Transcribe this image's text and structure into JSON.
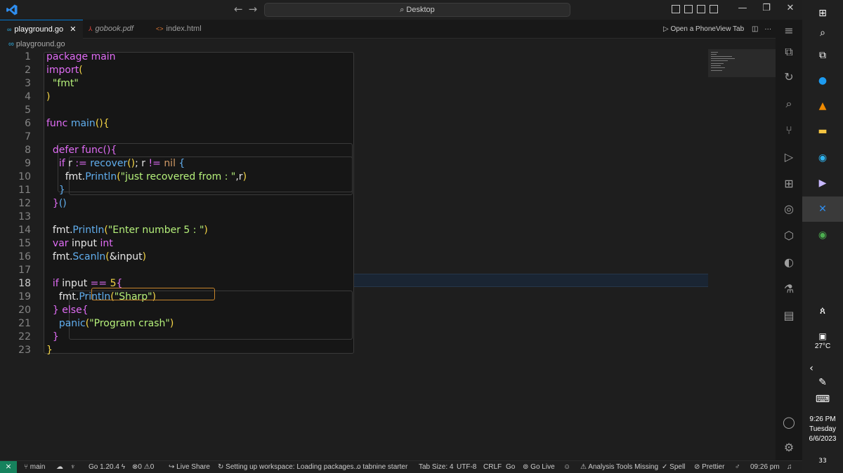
{
  "titlebar": {
    "search_label": "Desktop",
    "nav_back": "←",
    "nav_forward": "→",
    "minimize": "—",
    "restore": "❐",
    "close": "✕"
  },
  "tabs": [
    {
      "label": "playground.go",
      "icon": "go-file-icon",
      "close": "✕"
    },
    {
      "label": "gobook.pdf",
      "icon": "pdf-file-icon"
    },
    {
      "label": "index.html",
      "icon": "html-file-icon"
    }
  ],
  "tab_actions": {
    "phoneview": "Open a PhoneView Tab",
    "more": "···"
  },
  "breadcrumb": {
    "file": "playground.go"
  },
  "editor": {
    "current_line": 18,
    "line_numbers": [
      "1",
      "2",
      "3",
      "4",
      "5",
      "6",
      "7",
      "8",
      "9",
      "10",
      "11",
      "12",
      "13",
      "14",
      "15",
      "16",
      "17",
      "18",
      "19",
      "20",
      "21",
      "22",
      "23"
    ]
  },
  "statusbar": {
    "branch": "main",
    "go_version": "Go 1.20.4",
    "errors": "0",
    "warnings": "0",
    "live_share": "Live Share",
    "workspace": "Setting up workspace: Loading packages...",
    "tabnine": "tabnine starter",
    "tab_size": "Tab Size: 4",
    "encoding": "UTF-8",
    "eol": "CRLF",
    "language": "Go",
    "go_live": "Go Live",
    "analysis": "Analysis Tools Missing",
    "spell": "Spell",
    "prettier": "Prettier",
    "time": "09:26 pm"
  },
  "taskbar": {
    "weather": "27°C",
    "time": "9:26 PM",
    "day": "Tuesday",
    "date": "6/6/2023",
    "notifications": "33"
  },
  "colors": {
    "accent": "#0078d4",
    "remote": "#16825d",
    "keyword": "#e06cf5",
    "function": "#61aeee",
    "string": "#b5f07a",
    "bracket": "#f5d547"
  }
}
